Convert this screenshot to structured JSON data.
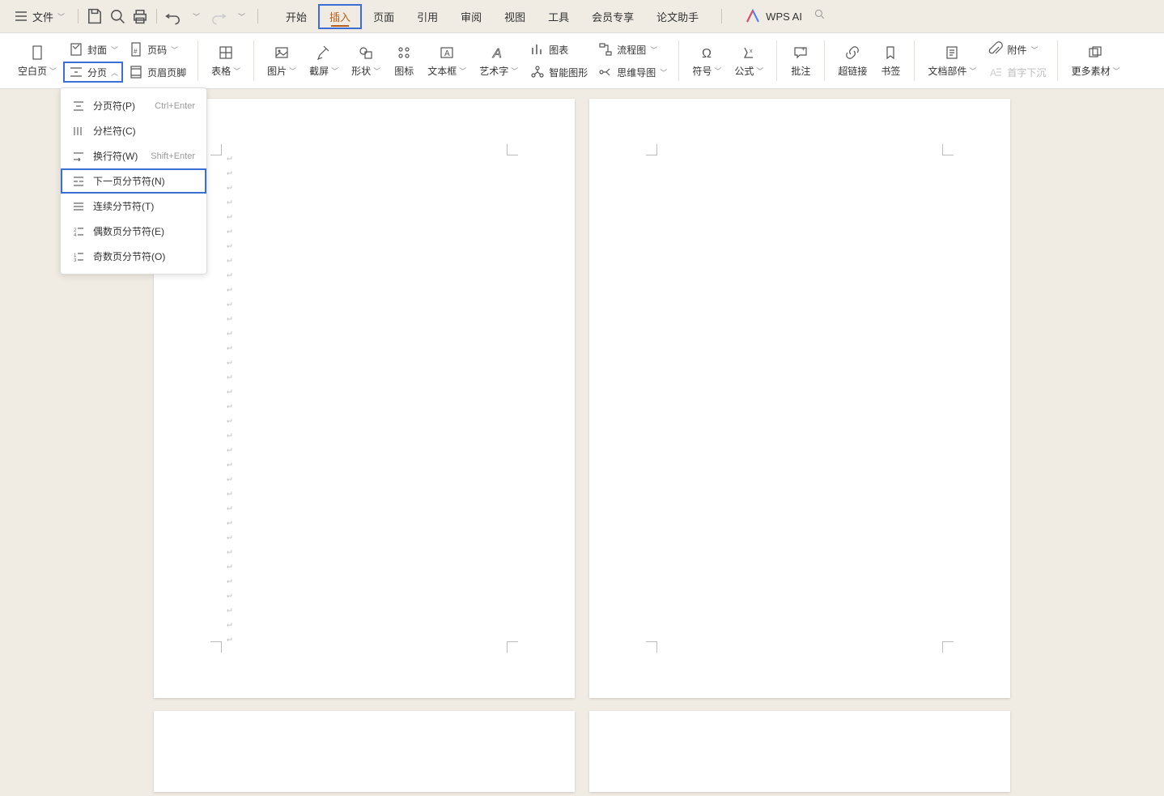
{
  "top": {
    "file": "文件",
    "wps_ai": "WPS AI"
  },
  "tabs": {
    "start": "开始",
    "insert": "插入",
    "page": "页面",
    "reference": "引用",
    "review": "审阅",
    "view": "视图",
    "tools": "工具",
    "member": "会员专享",
    "paper": "论文助手"
  },
  "ribbon": {
    "blank_page": "空白页",
    "cFover": "封面",
    "page_number": "页码",
    "section": "分页",
    "header_footer": "页眉页脚",
    "table": "表格",
    "picture": "图片",
    "screenshot": "截屏",
    "shape": "形状",
    "icon": "图标",
    "textbox": "文本框",
    "wordart": "艺术字",
    "chart": "图表",
    "flowchart": "流程图",
    "smart_graphic": "智能图形",
    "mindmap": "思维导图",
    "symbol": "符号",
    "formula": "公式",
    "comment": "批注",
    "hyperlink": "超链接",
    "bookmark": "书签",
    "doc_parts": "文档部件",
    "drop_cap": "首字下沉",
    "attachment": "附件",
    "more_material": "更多素材"
  },
  "dropdown": {
    "page_break": "分页符(P)",
    "page_break_key": "Ctrl+Enter",
    "column_break": "分栏符(C)",
    "line_break": "换行符(W)",
    "line_break_key": "Shift+Enter",
    "next_page_section": "下一页分节符(N)",
    "continuous_section": "连续分节符(T)",
    "even_page_section": "偶数页分节符(E)",
    "odd_page_section": "奇数页分节符(O)"
  }
}
